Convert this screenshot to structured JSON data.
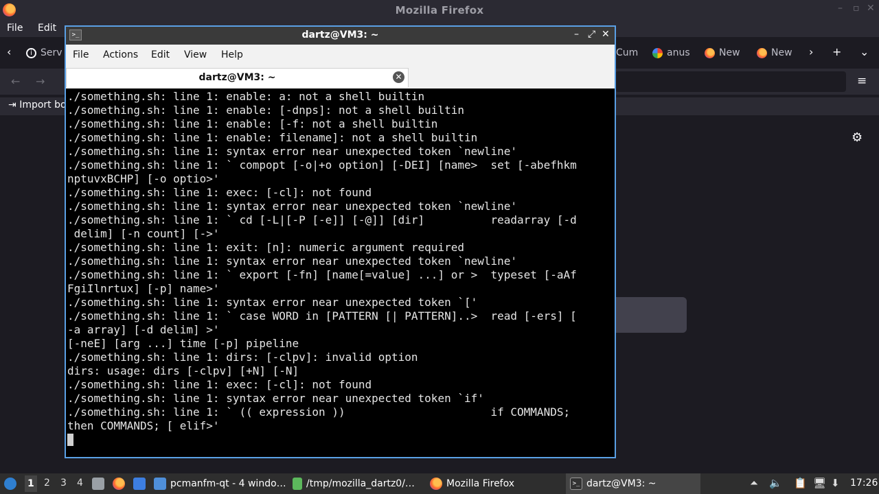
{
  "firefox": {
    "window_title": "Mozilla Firefox",
    "menu": [
      "File",
      "Edit"
    ],
    "tabs": [
      {
        "label": "Serv",
        "icon": "info-icon"
      },
      {
        "label": "Cum",
        "icon": "tab-icon"
      },
      {
        "label": "anus",
        "icon": "google-icon"
      },
      {
        "label": "New",
        "icon": "firefox-icon"
      },
      {
        "label": "New",
        "icon": "firefox-icon"
      }
    ],
    "bookmarks_label": "Import bo",
    "settings_icon": "gear-icon"
  },
  "terminal": {
    "window_title": "dartz@VM3: ~",
    "menu": [
      "File",
      "Actions",
      "Edit",
      "View",
      "Help"
    ],
    "tab_label": "dartz@VM3: ~",
    "lines": [
      "./something.sh: line 1: enable: a: not a shell builtin",
      "./something.sh: line 1: enable: [-dnps]: not a shell builtin",
      "./something.sh: line 1: enable: [-f: not a shell builtin",
      "./something.sh: line 1: enable: filename]: not a shell builtin",
      "./something.sh: line 1: syntax error near unexpected token `newline'",
      "./something.sh: line 1: ` compopt [-o|+o option] [-DEI] [name>  set [-abefhkm",
      "nptuvxBCHP] [-o optio>'",
      "./something.sh: line 1: exec: [-cl]: not found",
      "./something.sh: line 1: syntax error near unexpected token `newline'",
      "./something.sh: line 1: ` cd [-L|[-P [-e]] [-@]] [dir]          readarray [-d",
      " delim] [-n count] [->'",
      "./something.sh: line 1: exit: [n]: numeric argument required",
      "./something.sh: line 1: syntax error near unexpected token `newline'",
      "./something.sh: line 1: ` export [-fn] [name[=value] ...] or >  typeset [-aAf",
      "FgiIlnrtux] [-p] name>'",
      "./something.sh: line 1: syntax error near unexpected token `['",
      "./something.sh: line 1: ` case WORD in [PATTERN [| PATTERN]..>  read [-ers] [",
      "-a array] [-d delim] >'",
      "[-neE] [arg ...] time [-p] pipeline",
      "./something.sh: line 1: dirs: [-clpv]: invalid option",
      "dirs: usage: dirs [-clpv] [+N] [-N]",
      "./something.sh: line 1: exec: [-cl]: not found",
      "./something.sh: line 1: syntax error near unexpected token `if'",
      "./something.sh: line 1: ` (( expression ))                      if COMMANDS;",
      "then COMMANDS; [ elif>'"
    ]
  },
  "taskbar": {
    "workspaces": [
      "1",
      "2",
      "3",
      "4"
    ],
    "tasks": [
      {
        "label": "pcmanfm-qt - 4 windo…",
        "icon": "folder-icon"
      },
      {
        "label": "/tmp/mozilla_dartz0/…",
        "icon": "archive-icon"
      },
      {
        "label": "Mozilla Firefox",
        "icon": "firefox-icon"
      },
      {
        "label": "dartz@VM3: ~",
        "icon": "terminal-icon"
      }
    ],
    "clock": "17:26"
  }
}
